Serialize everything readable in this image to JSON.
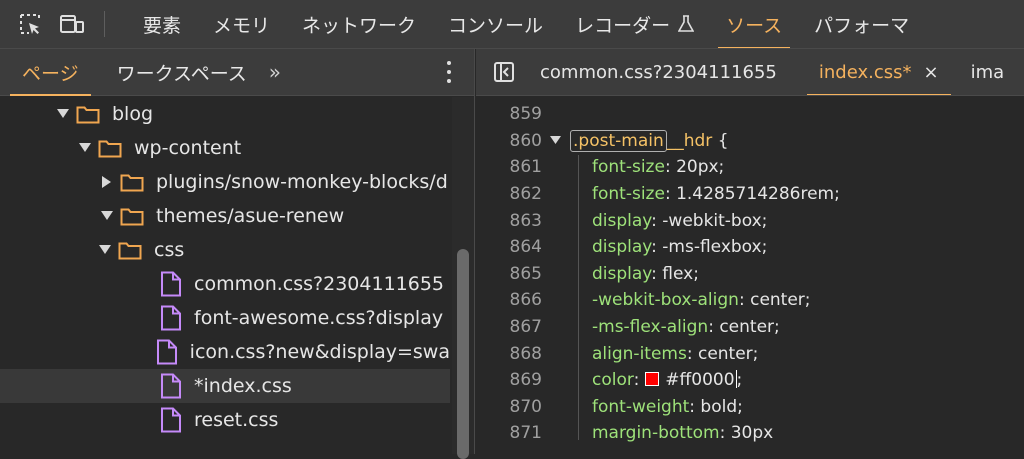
{
  "toolbar": {
    "tabs": [
      "要素",
      "メモリ",
      "ネットワーク",
      "コンソール",
      "レコーダー",
      "ソース",
      "パフォーマ"
    ],
    "active_tab_index": 5,
    "icons": [
      "inspect-icon",
      "device-toggle-icon",
      "flask-icon"
    ]
  },
  "navigator": {
    "tabs": [
      "ページ",
      "ワークスペース"
    ],
    "more": "»",
    "active_tab_index": 0,
    "tree": [
      {
        "label": "blog",
        "type": "folder",
        "expanded": true,
        "depth": 0
      },
      {
        "label": "wp-content",
        "type": "folder",
        "expanded": true,
        "depth": 1
      },
      {
        "label": "plugins/snow-monkey-blocks/d",
        "type": "folder",
        "expanded": false,
        "depth": 2
      },
      {
        "label": "themes/asue-renew",
        "type": "folder",
        "expanded": true,
        "depth": 2
      },
      {
        "label": "css",
        "type": "folder",
        "expanded": true,
        "depth": 3
      },
      {
        "label": "common.css?2304111655",
        "type": "file",
        "depth": 4
      },
      {
        "label": "font-awesome.css?display",
        "type": "file",
        "depth": 4
      },
      {
        "label": "icon.css?new&display=swa",
        "type": "file",
        "depth": 4
      },
      {
        "label": "*index.css",
        "type": "file",
        "depth": 4,
        "selected": true
      },
      {
        "label": "reset.css",
        "type": "file",
        "depth": 4
      }
    ]
  },
  "editor": {
    "tabs": [
      {
        "label": "common.css?2304111655",
        "active": false
      },
      {
        "label": "index.css*",
        "active": true,
        "closable": true
      },
      {
        "label": "ima",
        "active": false
      }
    ],
    "close_glyph": "×",
    "lines": [
      {
        "n": "859"
      },
      {
        "n": "860",
        "selector_a": ".post-main",
        "selector_b": "__hdr",
        "brace": " {",
        "fold": true
      },
      {
        "n": "861",
        "prop": "font-size",
        "val": " 20px;"
      },
      {
        "n": "862",
        "prop": "font-size",
        "val": " 1.4285714286rem;"
      },
      {
        "n": "863",
        "prop": "display",
        "val": " -webkit-box;"
      },
      {
        "n": "864",
        "prop": "display",
        "val": " -ms-flexbox;"
      },
      {
        "n": "865",
        "prop": "display",
        "val": " flex;"
      },
      {
        "n": "866",
        "prop": "-webkit-box-align",
        "val": " center;"
      },
      {
        "n": "867",
        "prop": "-ms-flex-align",
        "val": " center;"
      },
      {
        "n": "868",
        "prop": "align-items",
        "val": " center;"
      },
      {
        "n": "869",
        "prop": "color",
        "val": "#ff0000",
        "tail": ";",
        "swatch": "#ff0000",
        "cursor": true
      },
      {
        "n": "870",
        "prop": "font-weight",
        "val": " bold;"
      },
      {
        "n": "871",
        "prop": "margin-bottom",
        "val": " 30px"
      }
    ],
    "colon": ":"
  },
  "colors": {
    "accent": "#f5b25e",
    "property": "#9ee27a",
    "file_icon": "#c58af9",
    "folder_icon": "#f0a650"
  }
}
